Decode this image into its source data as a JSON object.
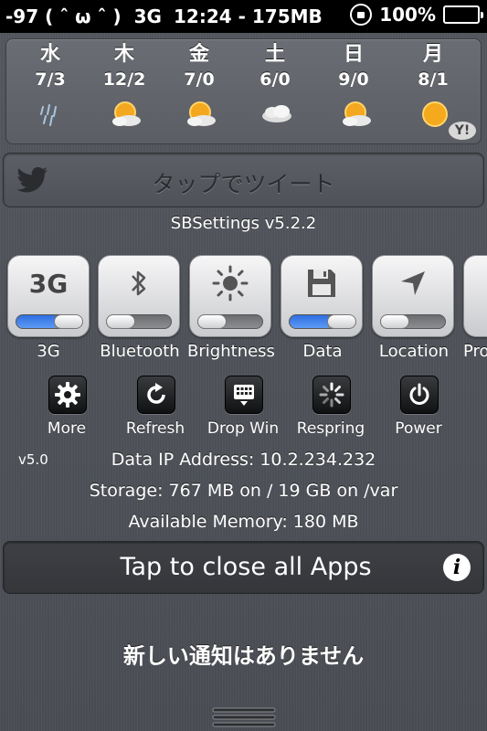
{
  "status_bar": {
    "signal": "-97 ( ˆ ω ˆ )",
    "network": "3G",
    "time_mem": "12:24 - 175MB",
    "battery": "100%",
    "battery_level": 1.0
  },
  "weather": {
    "days": [
      {
        "day": "水",
        "temps": "7/3",
        "icon": "rain-icon"
      },
      {
        "day": "木",
        "temps": "12/2",
        "icon": "sun-cloud-icon"
      },
      {
        "day": "金",
        "temps": "7/0",
        "icon": "sun-cloud-icon"
      },
      {
        "day": "土",
        "temps": "6/0",
        "icon": "cloud-icon"
      },
      {
        "day": "日",
        "temps": "9/0",
        "icon": "sun-cloud-icon"
      },
      {
        "day": "月",
        "temps": "8/1",
        "icon": "sun-icon"
      }
    ],
    "provider_badge": "Y!"
  },
  "tweet": {
    "label": "タップでツイート",
    "icon": "twitter-bird-icon"
  },
  "sbsettings": {
    "title": "SBSettings v5.2.2"
  },
  "toggles": [
    {
      "label": "3G",
      "glyph": "3G",
      "icon": "3g-text",
      "on": true
    },
    {
      "label": "Bluetooth",
      "icon": "bluetooth-icon",
      "on": false
    },
    {
      "label": "Brightness",
      "icon": "sun-brightness-icon",
      "on": false
    },
    {
      "label": "Data",
      "icon": "floppy-disk-icon",
      "on": true
    },
    {
      "label": "Location",
      "icon": "location-arrow-icon",
      "on": false
    },
    {
      "label": "Pro",
      "icon": "partial-icon",
      "on": false
    }
  ],
  "actions": [
    {
      "label": "More",
      "icon": "gear-icon"
    },
    {
      "label": "Refresh",
      "icon": "refresh-icon"
    },
    {
      "label": "Drop Win",
      "icon": "keyboard-icon"
    },
    {
      "label": "Respring",
      "icon": "spinner-icon"
    },
    {
      "label": "Power",
      "icon": "power-icon"
    }
  ],
  "info": {
    "version": "v5.0",
    "ip": "Data IP Address: 10.2.234.232",
    "storage": "Storage: 767 MB on / 19 GB on /var",
    "memory": "Available Memory: 180 MB"
  },
  "close_apps": {
    "label": "Tap to close all Apps",
    "info_glyph": "i"
  },
  "notifications": {
    "empty": "新しい通知はありません"
  },
  "colors": {
    "toggle_on": "#3b7ae8",
    "background": "#505359"
  }
}
